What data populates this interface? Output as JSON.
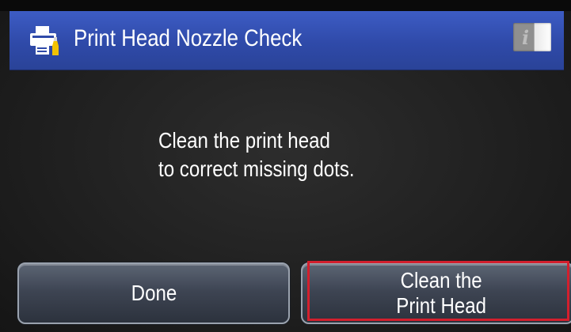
{
  "header": {
    "title": "Print Head Nozzle Check",
    "left_icon": "printer-icon",
    "right_icon": "info-icon",
    "right_icon_glyph": "i",
    "background_color": "#2f4aa9"
  },
  "main": {
    "message_line1": "Clean the print head",
    "message_line2": "to correct missing dots."
  },
  "buttons": {
    "done_label": "Done",
    "clean_label_line1": "Clean the",
    "clean_label_line2": "Print Head",
    "highlight_color": "#d31f2d"
  }
}
